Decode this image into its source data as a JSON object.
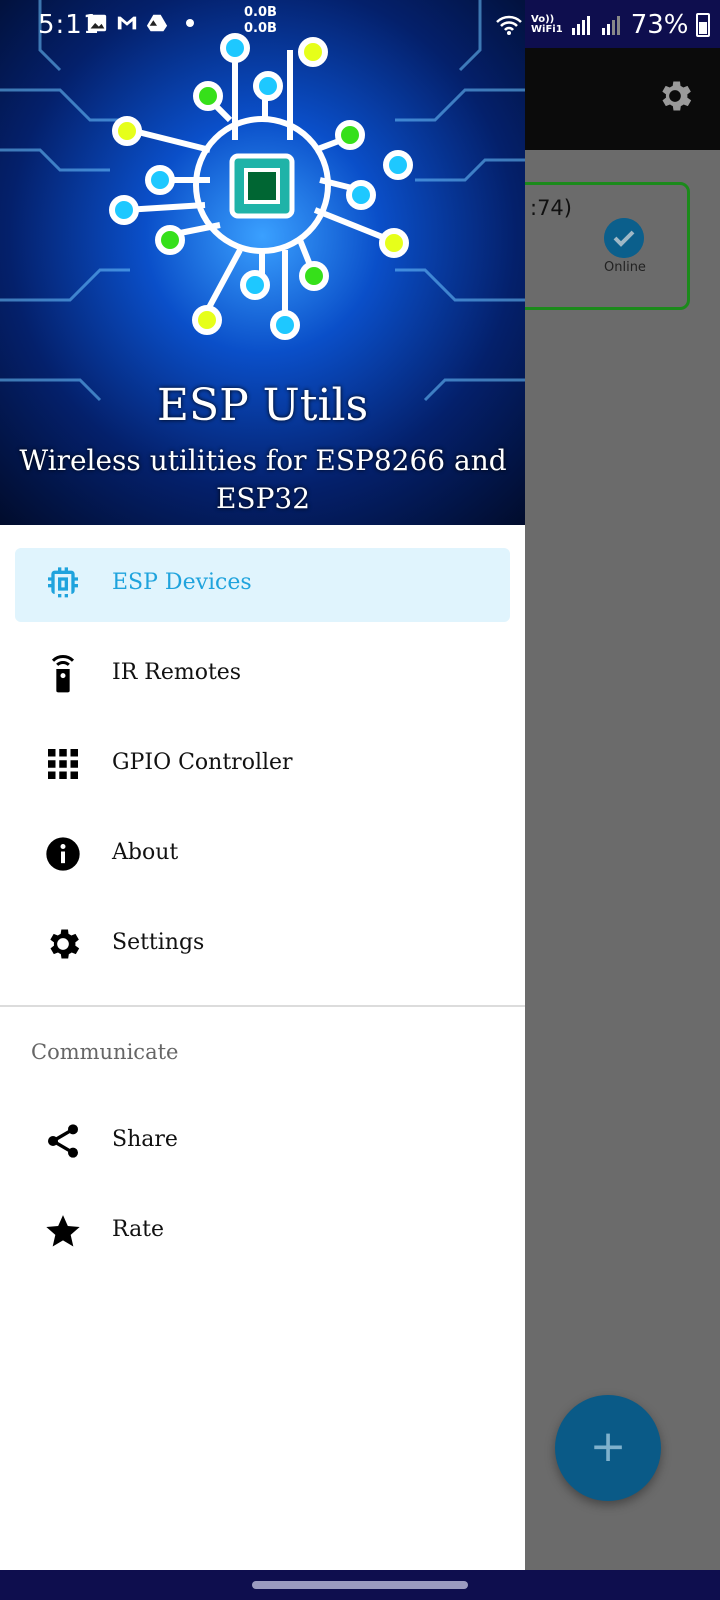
{
  "status_bar": {
    "time": "5:11",
    "net_speed_up": "0.0B",
    "net_speed_down": "0.0B",
    "network_label_1": "Vo))",
    "network_label_2": "WiFi1",
    "battery": "73%"
  },
  "drawer": {
    "header": {
      "title": "ESP Utils",
      "subtitle": "Wireless utilities for ESP8266 and ESP32"
    },
    "items": [
      {
        "label": "ESP Devices",
        "icon": "chip-icon",
        "active": true
      },
      {
        "label": "IR Remotes",
        "icon": "remote-icon",
        "active": false
      },
      {
        "label": "GPIO Controller",
        "icon": "grid-icon",
        "active": false
      },
      {
        "label": "About",
        "icon": "info-icon",
        "active": false
      },
      {
        "label": "Settings",
        "icon": "gear-icon",
        "active": false
      }
    ],
    "section_communicate": "Communicate",
    "communicate_items": [
      {
        "label": "Share",
        "icon": "share-icon"
      },
      {
        "label": "Rate",
        "icon": "star-icon"
      }
    ]
  },
  "background_app": {
    "device_card_text": ":74)",
    "device_status": "Online",
    "fab_label": "+"
  },
  "colors": {
    "accent": "#1fa3dd",
    "active_bg": "#e0f4fd",
    "status_bar": "#0e0e4e",
    "online_border": "#1b8a1b",
    "fab": "#0a5a87"
  }
}
